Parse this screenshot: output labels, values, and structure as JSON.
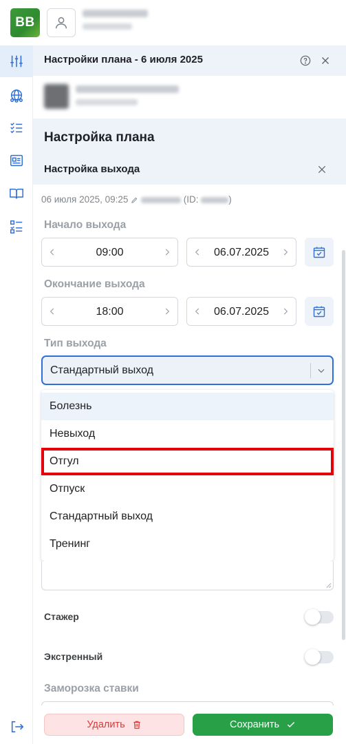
{
  "app": {
    "logo_text": "BB",
    "brand_color": "#2f8b2f"
  },
  "sidebar": {
    "items": [
      {
        "icon": "sliders-icon",
        "active": true
      },
      {
        "icon": "globe-people-icon",
        "active": false
      },
      {
        "icon": "checklist-icon",
        "active": false
      },
      {
        "icon": "id-card-icon",
        "active": false
      },
      {
        "icon": "book-icon",
        "active": false
      },
      {
        "icon": "task-list-icon",
        "active": false
      }
    ],
    "logout_icon": "logout-icon"
  },
  "panel": {
    "title": "Настройки плана - 6 июля 2025"
  },
  "section": {
    "title": "Настройка плана",
    "subtitle": "Настройка выхода"
  },
  "meta": {
    "created": "06 июля 2025, 09:25",
    "id_prefix": "(ID:",
    "id_suffix": ")"
  },
  "form": {
    "start_label": "Начало выхода",
    "start_time": "09:00",
    "start_date": "06.07.2025",
    "end_label": "Окончание выхода",
    "end_time": "18:00",
    "end_date": "06.07.2025",
    "type_label": "Тип выхода",
    "type_value": "Стандартный выход",
    "options": [
      "Болезнь",
      "Невыход",
      "Отгул",
      "Отпуск",
      "Стандартный выход",
      "Тренинг"
    ],
    "hovered_option": "Болезнь",
    "highlighted_option": "Отгул",
    "trainee_label": "Стажер",
    "trainee_on": false,
    "emergency_label": "Экстренный",
    "emergency_on": false,
    "freeze_label": "Заморозка ставки"
  },
  "buttons": {
    "delete_label": "Удалить",
    "save_label": "Сохранить"
  },
  "colors": {
    "accent": "#2f6fd6",
    "save": "#27a048",
    "delete_text": "#d93a3a",
    "highlight": "#e3000b"
  }
}
